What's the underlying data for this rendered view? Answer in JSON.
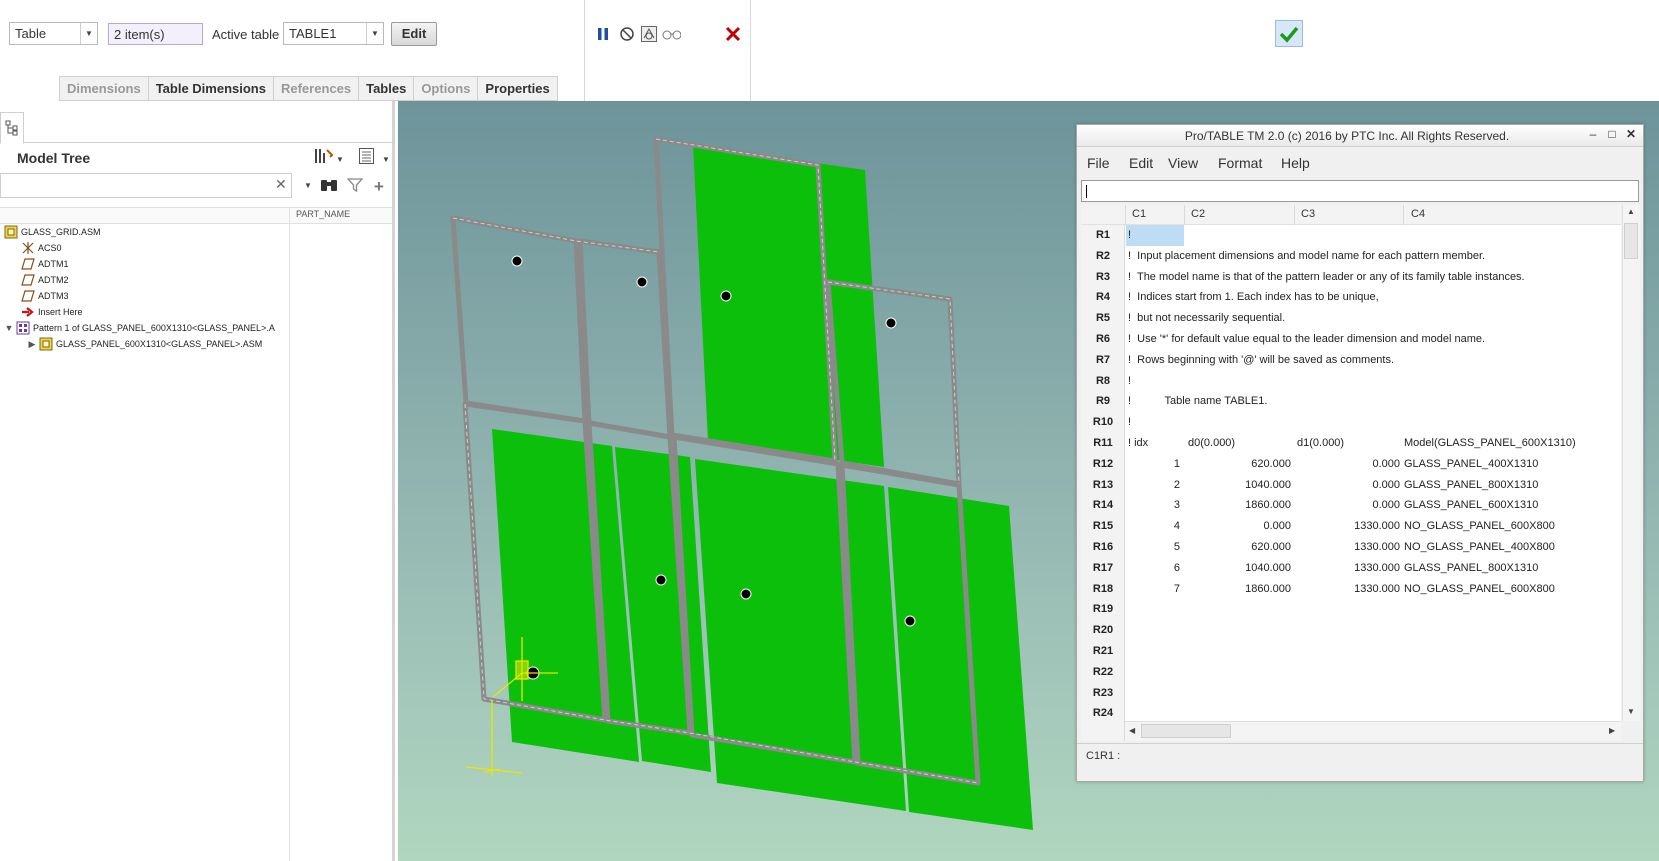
{
  "dashboard": {
    "type_combo": "Table",
    "items_box": "2 item(s)",
    "active_label": "Active table",
    "active_combo": "TABLE1",
    "edit_label": "Edit",
    "tabs": [
      {
        "label": "Dimensions",
        "enabled": false
      },
      {
        "label": "Table Dimensions",
        "enabled": true
      },
      {
        "label": "References",
        "enabled": false
      },
      {
        "label": "Tables",
        "enabled": true
      },
      {
        "label": "Options",
        "enabled": false
      },
      {
        "label": "Properties",
        "enabled": true
      }
    ],
    "icons": [
      "pause-icon",
      "stop-icon",
      "preview-icon",
      "glasses-icon",
      "checkmark-icon",
      "cancel-x-icon"
    ]
  },
  "tree": {
    "title": "Model Tree",
    "column_header": "PART_NAME",
    "items": [
      {
        "label": "GLASS_GRID.ASM",
        "icon": "assembly-icon"
      },
      {
        "label": "ACS0",
        "icon": "coordinate-system-icon"
      },
      {
        "label": "ADTM1",
        "icon": "datum-plane-icon"
      },
      {
        "label": "ADTM2",
        "icon": "datum-plane-icon"
      },
      {
        "label": "ADTM3",
        "icon": "datum-plane-icon"
      },
      {
        "label": "Insert Here",
        "icon": "insert-arrow-icon"
      },
      {
        "label": "Pattern 1 of GLASS_PANEL_600X1310<GLASS_PANEL>.A",
        "icon": "pattern-icon"
      },
      {
        "label": "GLASS_PANEL_600X1310<GLASS_PANEL>.ASM",
        "icon": "assembly-icon"
      }
    ]
  },
  "protable": {
    "title": "Pro/TABLE  TM  2.0  (c) 2016 by PTC Inc.  All Rights Reserved.",
    "menus": [
      "File",
      "Edit",
      "View",
      "Format",
      "Help"
    ],
    "columns": [
      "C1",
      "C2",
      "C3",
      "C4"
    ],
    "row_labels": [
      "R1",
      "R2",
      "R3",
      "R4",
      "R5",
      "R6",
      "R7",
      "R8",
      "R9",
      "R10",
      "R11",
      "R12",
      "R13",
      "R14",
      "R15",
      "R16",
      "R17",
      "R18",
      "R19",
      "R20",
      "R21",
      "R22",
      "R23",
      "R24"
    ],
    "comment_lines": [
      "!",
      "!  Input placement dimensions and model name for each pattern member.",
      "!  The model name is that of the pattern leader or any of its family table instances.",
      "!  Indices start from 1. Each index has to be unique,",
      "!  but not necessarily sequential.",
      "!  Use '*' for default value equal to the leader dimension and model name.",
      "!  Rows beginning with '@' will be saved as comments.",
      "!",
      "!           Table name TABLE1.",
      "!"
    ],
    "header_row": {
      "c1": "! idx",
      "c2": "d0(0.000)",
      "c3": "d1(0.000)",
      "c4": "Model(GLASS_PANEL_600X1310)"
    },
    "data_rows": [
      {
        "idx": "1",
        "d0": "620.000",
        "d1": "0.000",
        "model": "GLASS_PANEL_400X1310"
      },
      {
        "idx": "2",
        "d0": "1040.000",
        "d1": "0.000",
        "model": "GLASS_PANEL_800X1310"
      },
      {
        "idx": "3",
        "d0": "1860.000",
        "d1": "0.000",
        "model": "GLASS_PANEL_600X1310"
      },
      {
        "idx": "4",
        "d0": "0.000",
        "d1": "1330.000",
        "model": "NO_GLASS_PANEL_600X800"
      },
      {
        "idx": "5",
        "d0": "620.000",
        "d1": "1330.000",
        "model": "NO_GLASS_PANEL_400X800"
      },
      {
        "idx": "6",
        "d0": "1040.000",
        "d1": "1330.000",
        "model": "GLASS_PANEL_800X1310"
      },
      {
        "idx": "7",
        "d0": "1860.000",
        "d1": "1330.000",
        "model": "NO_GLASS_PANEL_600X800"
      }
    ],
    "status": "C1R1 :"
  },
  "colors": {
    "glass_green": "#0bbf0b",
    "frame_gray": "#8a8a8a",
    "selection_blue": "#bfdcf5",
    "ok_green": "#1a9a1a",
    "cancel_red": "#c00000"
  }
}
